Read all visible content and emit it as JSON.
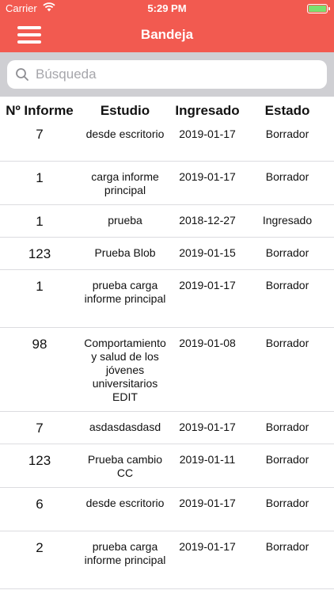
{
  "status_bar": {
    "carrier": "Carrier",
    "time": "5:29 PM",
    "battery_color": "#7be06f"
  },
  "nav": {
    "title": "Bandeja",
    "bar_color": "#f25a50"
  },
  "search": {
    "placeholder": "Búsqueda",
    "value": ""
  },
  "table": {
    "headers": [
      "Nº Informe",
      "Estudio",
      "Ingresado",
      "Estado"
    ],
    "rows": [
      {
        "numero": "7",
        "estudio": "desde escritorio",
        "ingresado": "2019-01-17",
        "estado": "Borrador"
      },
      {
        "numero": "1",
        "estudio": "carga informe principal",
        "ingresado": "2019-01-17",
        "estado": "Borrador"
      },
      {
        "numero": "1",
        "estudio": "prueba",
        "ingresado": "2018-12-27",
        "estado": "Ingresado"
      },
      {
        "numero": "123",
        "estudio": "Prueba Blob",
        "ingresado": "2019-01-15",
        "estado": "Borrador"
      },
      {
        "numero": "1",
        "estudio": "prueba carga informe principal",
        "ingresado": "2019-01-17",
        "estado": "Borrador"
      },
      {
        "numero": "98",
        "estudio": "Comportamiento y salud de los jóvenes universitarios EDIT",
        "ingresado": "2019-01-08",
        "estado": "Borrador"
      },
      {
        "numero": "7",
        "estudio": "asdasdasdasd",
        "ingresado": "2019-01-17",
        "estado": "Borrador"
      },
      {
        "numero": "123",
        "estudio": "Prueba cambio CC",
        "ingresado": "2019-01-11",
        "estado": "Borrador"
      },
      {
        "numero": "6",
        "estudio": "desde escritorio",
        "ingresado": "2019-01-17",
        "estado": "Borrador"
      },
      {
        "numero": "2",
        "estudio": "prueba carga informe principal",
        "ingresado": "2019-01-17",
        "estado": "Borrador"
      }
    ]
  }
}
